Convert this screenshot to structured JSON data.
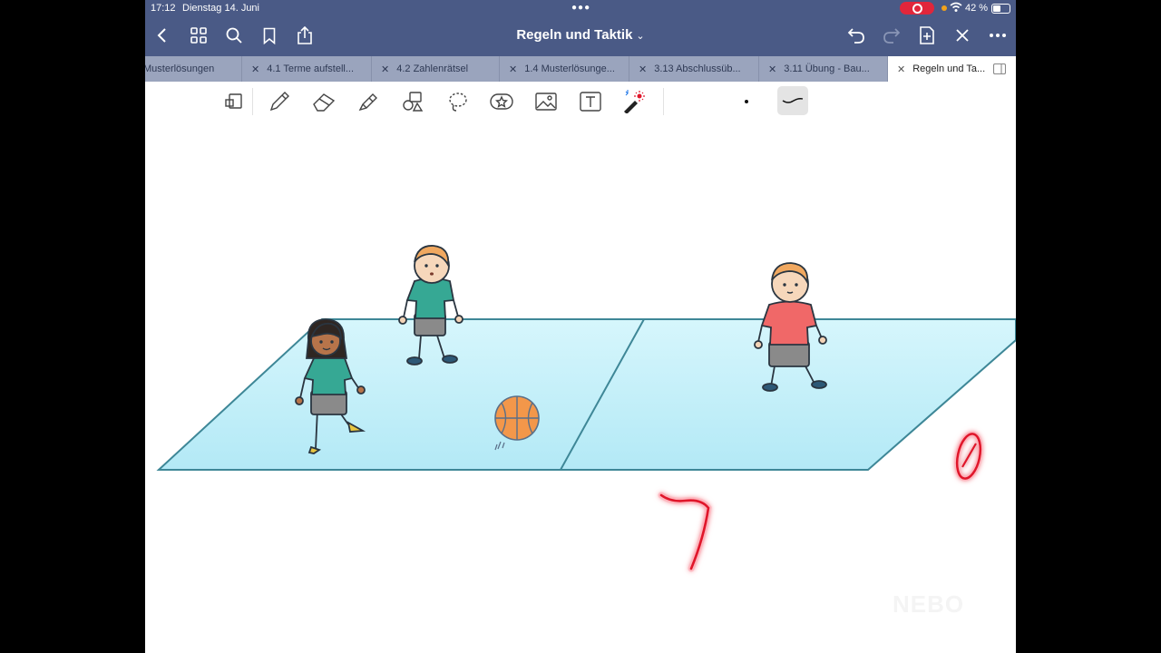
{
  "status": {
    "time": "17:12",
    "date": "Dienstag 14. Juni",
    "battery": "42 %",
    "battery_level": 0.42
  },
  "nav": {
    "doc_title": "Regeln und Taktik",
    "back_icon": "chevron-left-icon",
    "grid_icon": "grid-icon",
    "search_icon": "search-icon",
    "bookmark_icon": "bookmark-icon",
    "share_icon": "share-icon",
    "undo_icon": "undo-icon",
    "redo_icon": "redo-icon",
    "add_page_icon": "add-page-icon",
    "close_icon": "close-icon",
    "more_icon": "more-icon"
  },
  "tabs": [
    {
      "label": "Musterlösungen"
    },
    {
      "label": "4.1 Terme aufstell..."
    },
    {
      "label": "4.2 Zahlenrätsel"
    },
    {
      "label": "1.4 Musterlösunge..."
    },
    {
      "label": "3.13 Abschlussüb..."
    },
    {
      "label": "3.11 Übung - Bau..."
    },
    {
      "label": "Regeln und Ta..."
    }
  ],
  "tools": [
    "page-zoom-icon",
    "pen-icon",
    "eraser-icon",
    "highlighter-icon",
    "shapes-icon",
    "lasso-icon",
    "sticker-icon",
    "image-icon",
    "text-icon",
    "laser-pointer-icon"
  ],
  "colors": {
    "nav_bg": "#4a5a86",
    "tab_bg": "#9aa4bd",
    "court": "#bfeffa",
    "court_line": "#3e8797",
    "laser": "#e0182c"
  },
  "watermark": "NEBO"
}
